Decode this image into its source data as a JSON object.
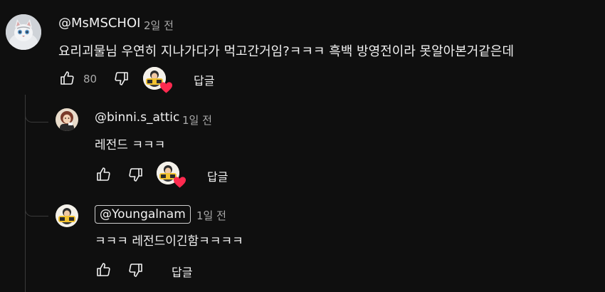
{
  "comment": {
    "author": "@MsMSCHOI",
    "time": "2일 전",
    "text": "요리괴물님 우연히 지나가다가 먹고간거임?ㅋㅋㅋ 흑백 방영전이라 못알아본거같은데",
    "like_count": "80",
    "reply_label": "답글",
    "icons": {
      "like": "thumb-up-icon",
      "dislike": "thumb-down-icon",
      "creator_heart": "creator-heart-icon"
    }
  },
  "replies": [
    {
      "author": "@binni.s_attic",
      "time": "1일 전",
      "text": "레전드 ㅋㅋㅋ",
      "reply_label": "답글",
      "creator_hearted": true
    },
    {
      "author": "@Youngalnam",
      "time": "1일 전",
      "text": "ㅋㅋㅋ 레전드이긴함ㅋㅋㅋㅋ",
      "reply_label": "답글",
      "is_creator": true,
      "creator_hearted": false
    }
  ],
  "colors": {
    "background": "#0f0f0f",
    "text_primary": "#f1f1f1",
    "text_secondary": "#aaaaaa",
    "heart": "#ff2a4f",
    "thread_line": "#3a3a3a"
  }
}
